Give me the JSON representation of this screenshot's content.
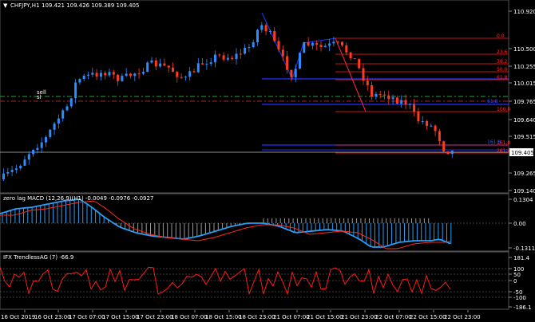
{
  "header": {
    "arrow": "▼",
    "symbol": "CHFJPY,H1",
    "ohlc": "109.421 109.426 109.389 109.405"
  },
  "colors": {
    "bull": "#2f8cff",
    "bear": "#ff3b1f",
    "grid": "#333333",
    "zigzag": "#1a3cff",
    "fib": "#ff2020",
    "macd_hist": "#2a9df4",
    "macd_signal": "#ff2a1a",
    "trend": "#ff1a1a"
  },
  "main_axis": {
    "ticks": [
      "110.920",
      "110.500",
      "110.255",
      "110.015",
      "109.765",
      "109.640",
      "109.515",
      "109.265",
      "109.140"
    ],
    "current_price": "109.405"
  },
  "sell_levels": {
    "sell": "sell",
    "sl": "sl"
  },
  "fib_levels": {
    "labels": [
      "0.0",
      "23.6",
      "38.2",
      "50.0",
      "61.8",
      "100.0",
      "161.8",
      "261.8"
    ],
    "blue_labels": [
      "61.8",
      "161.8"
    ]
  },
  "macd": {
    "title": "zero lag MACD (12,26,9)(H1) -0.0049 -0.0976 -0.0927",
    "ticks": [
      "0.1304",
      "0.00",
      "-0.1311"
    ]
  },
  "trend": {
    "title": "IFX TrendlessAG (7) -66.9",
    "ticks": [
      "181.4",
      "100",
      "50",
      "0",
      "-50",
      "-100",
      "-186.1"
    ]
  },
  "time_axis": [
    "16 Oct 2019",
    "16 Oct 23:00",
    "17 Oct 07:00",
    "17 Oct 15:00",
    "17 Oct 23:00",
    "18 Oct 07:00",
    "18 Oct 15:00",
    "18 Oct 23:00",
    "21 Oct 07:00",
    "21 Oct 15:00",
    "21 Oct 23:00",
    "22 Oct 07:00",
    "22 Oct 15:00",
    "22 Oct 23:00"
  ]
}
